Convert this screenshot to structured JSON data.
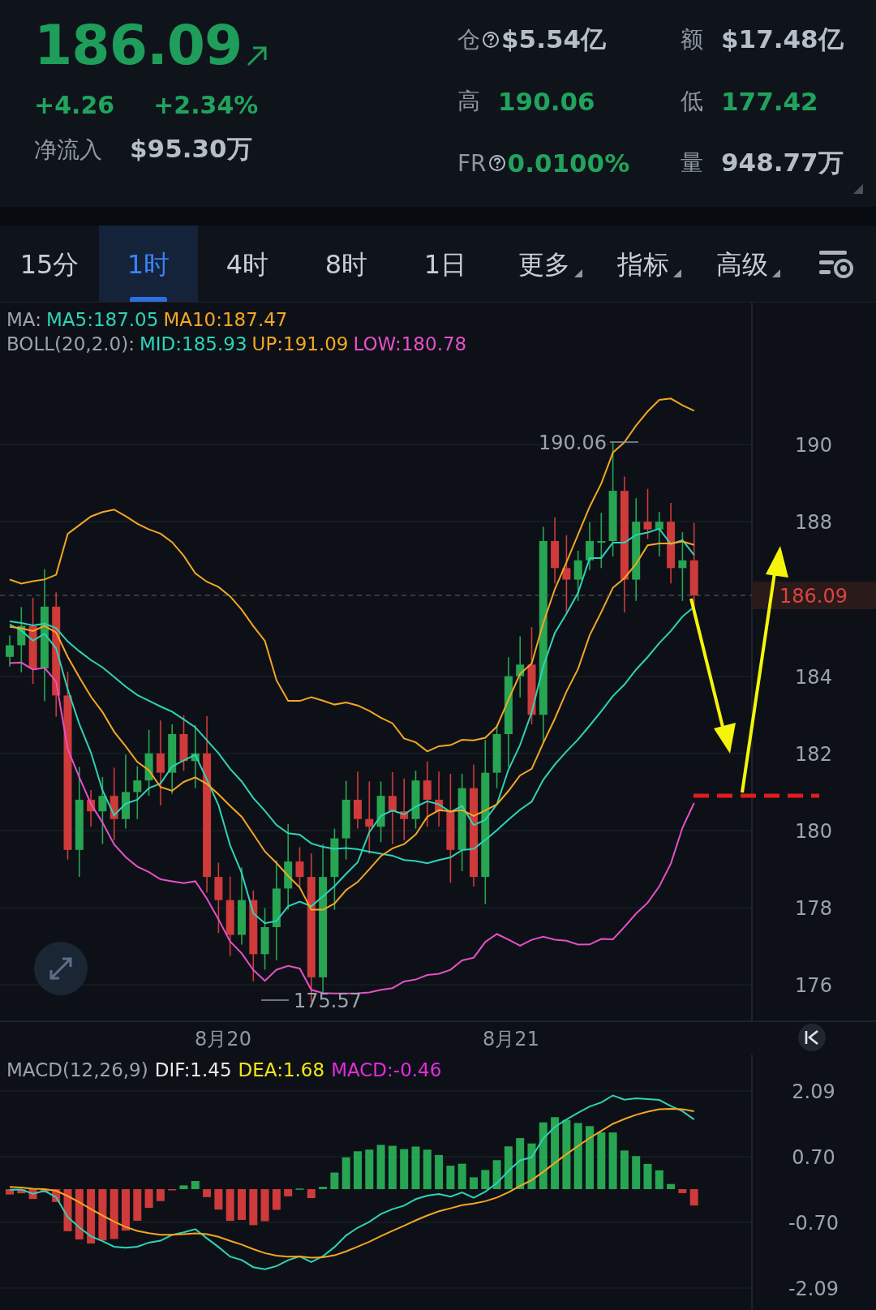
{
  "header": {
    "price": "186.09",
    "change": "+4.26",
    "change_percent": "+2.34%",
    "net_inflow": {
      "label": "净流入",
      "value": "$95.30万"
    },
    "stats": [
      {
        "label": "仓",
        "help": true,
        "value": "$5.54亿",
        "kind": "neutral"
      },
      {
        "label": "额",
        "help": false,
        "value": "$17.48亿",
        "kind": "neutral"
      },
      {
        "label": "高",
        "help": false,
        "value": "190.06",
        "kind": "up"
      },
      {
        "label": "低",
        "help": false,
        "value": "177.42",
        "kind": "up"
      },
      {
        "label": "FR",
        "help": true,
        "value": "0.0100%",
        "kind": "up"
      },
      {
        "label": "量",
        "help": false,
        "value": "948.77万",
        "kind": "neutral"
      }
    ]
  },
  "tabs": [
    {
      "label": "15分",
      "selected": false,
      "kind": "interval"
    },
    {
      "label": "1时",
      "selected": true,
      "kind": "interval"
    },
    {
      "label": "4时",
      "selected": false,
      "kind": "interval"
    },
    {
      "label": "8时",
      "selected": false,
      "kind": "interval"
    },
    {
      "label": "1日",
      "selected": false,
      "kind": "interval"
    },
    {
      "label": "更多",
      "selected": false,
      "kind": "dropdown"
    },
    {
      "label": "指标",
      "selected": false,
      "kind": "dropdown"
    },
    {
      "label": "高级",
      "selected": false,
      "kind": "dropdown"
    }
  ],
  "chart": {
    "ma_legend": {
      "label": "MA:",
      "items": [
        {
          "text": "MA5:187.05",
          "color": "#2ed3b7"
        },
        {
          "text": "MA10:187.47",
          "color": "#f5a623"
        }
      ]
    },
    "boll_legend": {
      "label": "BOLL(20,2.0):",
      "items": [
        {
          "text": "MID:185.93",
          "color": "#2ed3b7"
        },
        {
          "text": "UP:191.09",
          "color": "#f5a623"
        },
        {
          "text": "LOW:180.78",
          "color": "#e84fc8"
        }
      ]
    },
    "price_ticks": [
      "190",
      "188",
      "184",
      "182",
      "180",
      "178",
      "176"
    ],
    "current_price": "186.09",
    "high_marker": "190.06",
    "low_marker": "175.57",
    "dates": [
      "8月20",
      "8月21"
    ]
  },
  "macd": {
    "legend": {
      "label": "MACD(12,26,9)",
      "items": [
        {
          "text": "DIF:1.45",
          "color": "#e8e8e8"
        },
        {
          "text": "DEA:1.68",
          "color": "#f2e41a"
        },
        {
          "text": "MACD:-0.46",
          "color": "#e22ce0"
        }
      ]
    },
    "ticks": [
      "2.09",
      "0.70",
      "-0.70",
      "-2.09"
    ]
  }
}
